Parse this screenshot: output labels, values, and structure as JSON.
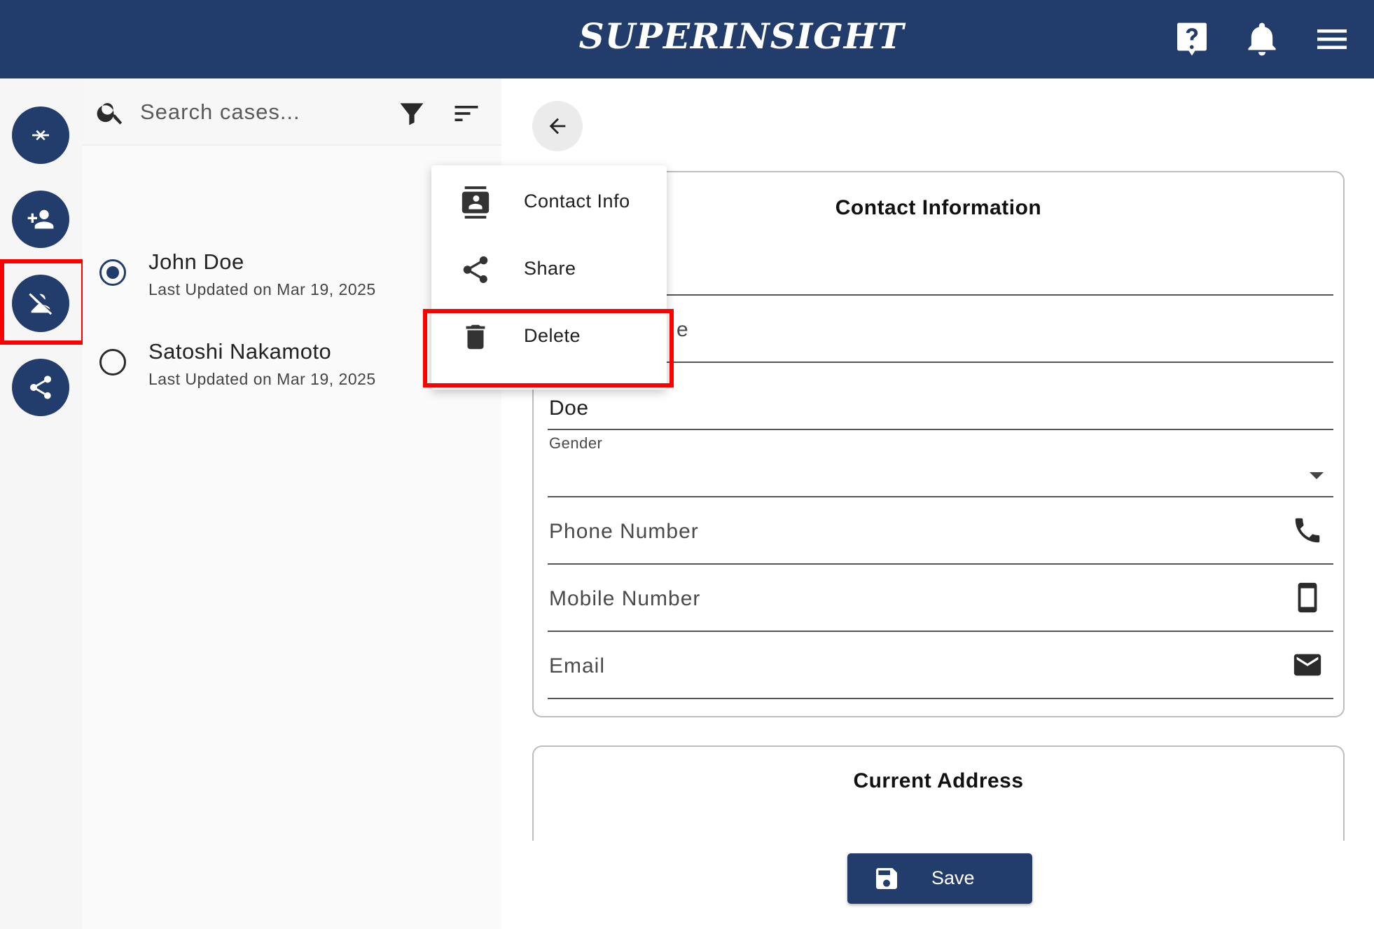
{
  "header": {
    "logo": "SUPERINSIGHT",
    "icons": [
      "help-icon",
      "notifications-bell-icon",
      "hamburger-menu-icon"
    ]
  },
  "rail": {
    "buttons": [
      "merge-icon",
      "add-person-icon",
      "person-off-icon",
      "share-icon"
    ],
    "highlight_color": "#ff0000"
  },
  "search": {
    "placeholder": "Search cases..."
  },
  "cases": [
    {
      "name": "John Doe",
      "updated": "Last Updated on Mar 19, 2025",
      "selected": true
    },
    {
      "name": "Satoshi Nakamoto",
      "updated": "Last Updated on Mar 19, 2025",
      "selected": false
    }
  ],
  "context_menu": {
    "items": [
      {
        "label": "Contact Info",
        "icon": "contact-card-icon"
      },
      {
        "label": "Share",
        "icon": "share-icon"
      },
      {
        "label": "Delete",
        "icon": "trash-icon"
      }
    ]
  },
  "contact_card": {
    "title": "Contact Information",
    "partial_label": "e",
    "last_name_value": "Doe",
    "gender_label": "Gender",
    "gender_value": "",
    "phone_placeholder": "Phone Number",
    "mobile_placeholder": "Mobile Number",
    "email_placeholder": "Email"
  },
  "address_card": {
    "title": "Current Address"
  },
  "save_button": {
    "label": "Save"
  },
  "colors": {
    "primary": "#223d6b",
    "highlight": "#ff0000"
  }
}
